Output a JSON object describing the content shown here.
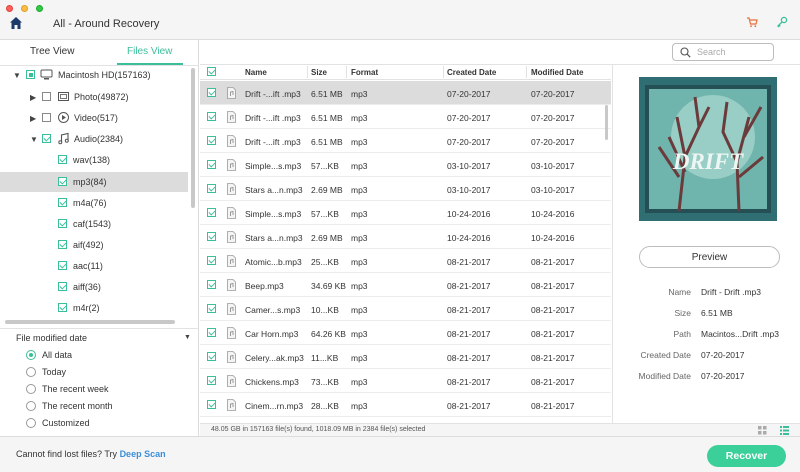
{
  "window": {
    "title": "All - Around Recovery"
  },
  "left_panel": {
    "tabs": [
      {
        "label": "Tree View"
      },
      {
        "label": "Files View"
      }
    ],
    "tree": {
      "root": {
        "label": "Macintosh HD(157163)"
      },
      "photo": {
        "label": "Photo(49872)"
      },
      "video": {
        "label": "Video(517)"
      },
      "audio": {
        "label": "Audio(2384)"
      },
      "children": [
        {
          "label": "wav(138)"
        },
        {
          "label": "mp3(84)"
        },
        {
          "label": "m4a(76)"
        },
        {
          "label": "caf(1543)"
        },
        {
          "label": "aif(492)"
        },
        {
          "label": "aac(11)"
        },
        {
          "label": "aiff(36)"
        },
        {
          "label": "m4r(2)"
        }
      ]
    },
    "filter": {
      "title": "File modified date",
      "options": [
        {
          "label": "All data"
        },
        {
          "label": "Today"
        },
        {
          "label": "The recent week"
        },
        {
          "label": "The recent month"
        },
        {
          "label": "Customized"
        }
      ]
    }
  },
  "search": {
    "placeholder": "Search"
  },
  "table": {
    "columns": {
      "name": "Name",
      "size": "Size",
      "format": "Format",
      "created": "Created Date",
      "modified": "Modified Date"
    },
    "rows": [
      {
        "name": "Drift -...ift .mp3",
        "size": "6.51 MB",
        "format": "mp3",
        "created": "07-20-2017",
        "modified": "07-20-2017"
      },
      {
        "name": "Drift -...ift .mp3",
        "size": "6.51 MB",
        "format": "mp3",
        "created": "07-20-2017",
        "modified": "07-20-2017"
      },
      {
        "name": "Drift -...ift .mp3",
        "size": "6.51 MB",
        "format": "mp3",
        "created": "07-20-2017",
        "modified": "07-20-2017"
      },
      {
        "name": "Simple...s.mp3",
        "size": "57...KB",
        "format": "mp3",
        "created": "03-10-2017",
        "modified": "03-10-2017"
      },
      {
        "name": "Stars a...n.mp3",
        "size": "2.69 MB",
        "format": "mp3",
        "created": "03-10-2017",
        "modified": "03-10-2017"
      },
      {
        "name": "Simple...s.mp3",
        "size": "57...KB",
        "format": "mp3",
        "created": "10-24-2016",
        "modified": "10-24-2016"
      },
      {
        "name": "Stars a...n.mp3",
        "size": "2.69 MB",
        "format": "mp3",
        "created": "10-24-2016",
        "modified": "10-24-2016"
      },
      {
        "name": "Atomic...b.mp3",
        "size": "25...KB",
        "format": "mp3",
        "created": "08-21-2017",
        "modified": "08-21-2017"
      },
      {
        "name": "Beep.mp3",
        "size": "34.69 KB",
        "format": "mp3",
        "created": "08-21-2017",
        "modified": "08-21-2017"
      },
      {
        "name": "Camer...s.mp3",
        "size": "10...KB",
        "format": "mp3",
        "created": "08-21-2017",
        "modified": "08-21-2017"
      },
      {
        "name": "Car Horn.mp3",
        "size": "64.26 KB",
        "format": "mp3",
        "created": "08-21-2017",
        "modified": "08-21-2017"
      },
      {
        "name": "Celery...ak.mp3",
        "size": "11...KB",
        "format": "mp3",
        "created": "08-21-2017",
        "modified": "08-21-2017"
      },
      {
        "name": "Chickens.mp3",
        "size": "73...KB",
        "format": "mp3",
        "created": "08-21-2017",
        "modified": "08-21-2017"
      },
      {
        "name": "Cinem...rn.mp3",
        "size": "28...KB",
        "format": "mp3",
        "created": "08-21-2017",
        "modified": "08-21-2017"
      }
    ]
  },
  "preview": {
    "album_text": "DRIFT",
    "button_label": "Preview",
    "info": [
      {
        "key": "Name",
        "value": "Drift - Drift .mp3"
      },
      {
        "key": "Size",
        "value": "6.51 MB"
      },
      {
        "key": "Path",
        "value": "Macintos...Drift .mp3"
      },
      {
        "key": "Created Date",
        "value": "07-20-2017"
      },
      {
        "key": "Modified Date",
        "value": "07-20-2017"
      }
    ]
  },
  "status": {
    "text": "48.05 GB in 157163 file(s) found, 1018.09 MB in 2384 file(s) selected"
  },
  "bottom": {
    "prompt": "Cannot find lost files? Try ",
    "deep_scan": "Deep Scan",
    "recover_label": "Recover"
  },
  "colors": {
    "accent": "#3bcf9a",
    "link": "#3b8fd8",
    "selected_row": "#dcdcdc"
  }
}
